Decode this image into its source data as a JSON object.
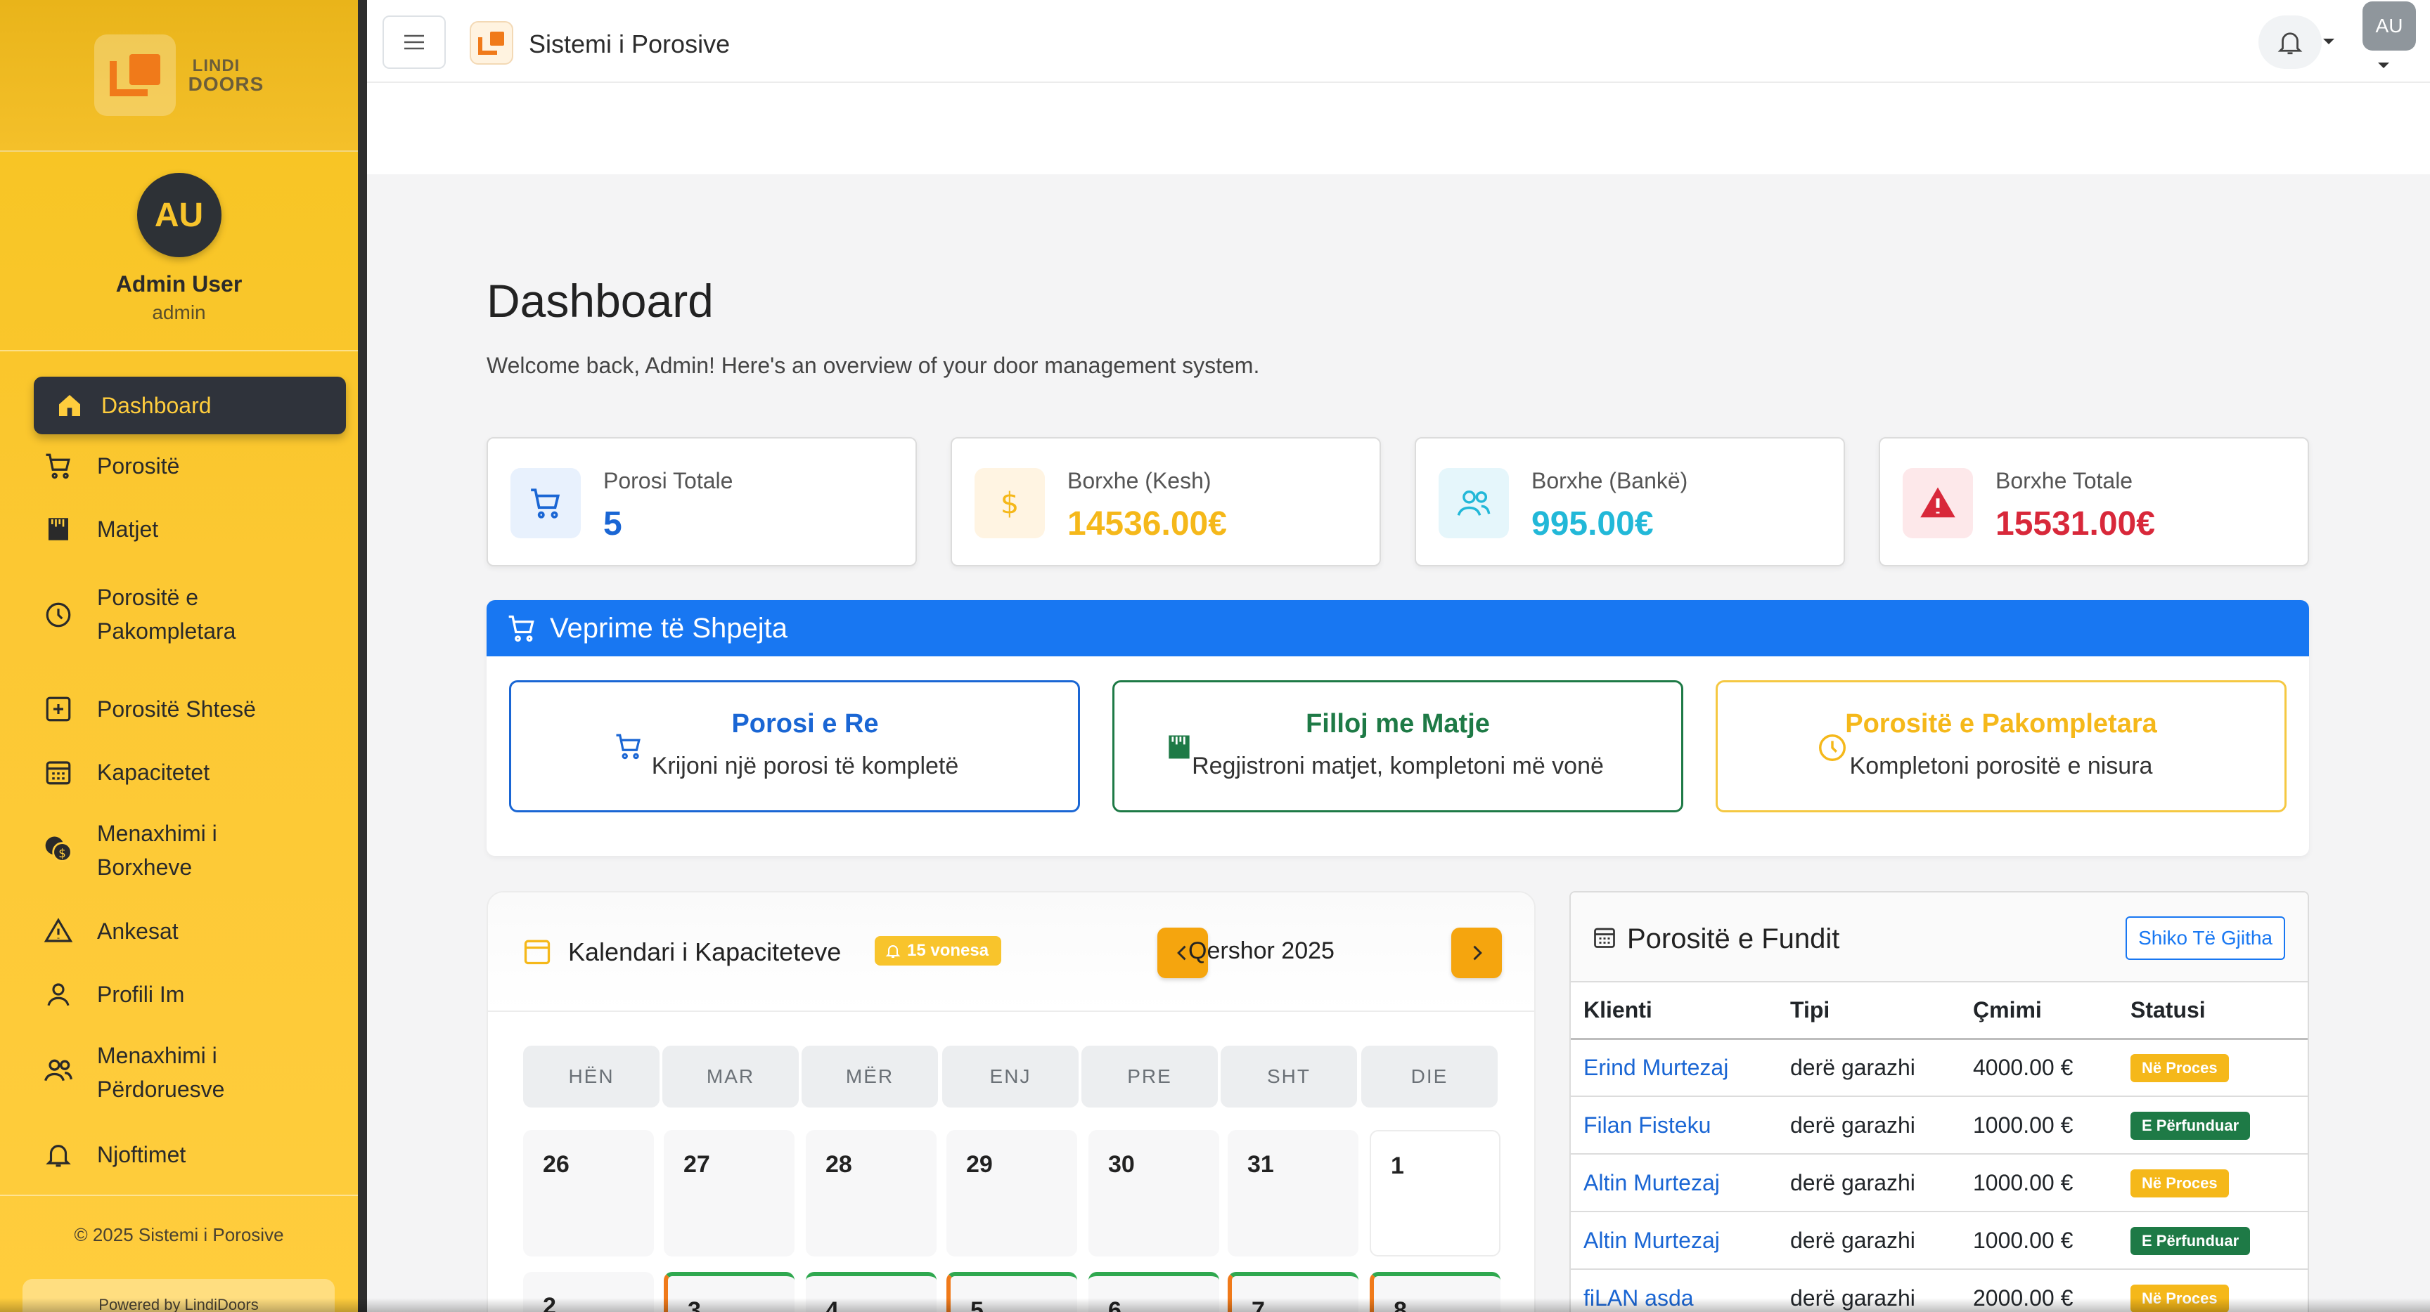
{
  "sidebar": {
    "logo_line1": "LINDI",
    "logo_line2": "DOORS",
    "avatar_initials": "AU",
    "user_name": "Admin User",
    "user_role": "admin",
    "items": [
      {
        "label": "Dashboard",
        "icon": "home-icon"
      },
      {
        "label": "Porositë",
        "icon": "cart-icon"
      },
      {
        "label": "Matjet",
        "icon": "ruler-icon"
      },
      {
        "label": "Porositë e Pakompletara",
        "icon": "clock-icon"
      },
      {
        "label": "Porositë Shtesë",
        "icon": "plus-square-icon"
      },
      {
        "label": "Kapacitetet",
        "icon": "calendar-grid-icon"
      },
      {
        "label": "Menaxhimi i Borxheve",
        "icon": "coins-icon"
      },
      {
        "label": "Ankesat",
        "icon": "warning-icon"
      },
      {
        "label": "Profili Im",
        "icon": "user-icon"
      },
      {
        "label": "Menaxhimi i Përdoruesve",
        "icon": "users-icon"
      },
      {
        "label": "Njoftimet",
        "icon": "bell-icon"
      }
    ],
    "footer": "© 2025 Sistemi i Porosive",
    "powered": "Powered by LindiDoors"
  },
  "topbar": {
    "title": "Sistemi i Porosive",
    "avatar": "AU"
  },
  "page": {
    "title": "Dashboard",
    "subtitle": "Welcome back, Admin! Here's an overview of your door management system."
  },
  "stats": [
    {
      "label": "Porosi Totale",
      "value": "5",
      "color": "#1a66d4",
      "bg": "#e8f1fd",
      "icon": "cart-icon"
    },
    {
      "label": "Borxhe (Kesh)",
      "value": "14536.00€",
      "color": "#f5b81a",
      "bg": "#fff4e2",
      "icon": "dollar-icon"
    },
    {
      "label": "Borxhe (Bankë)",
      "value": "995.00€",
      "color": "#22b8d8",
      "bg": "#e5f6fb",
      "icon": "users-icon"
    },
    {
      "label": "Borxhe Totale",
      "value": "15531.00€",
      "color": "#d8283a",
      "bg": "#fde8ea",
      "icon": "warning-icon"
    }
  ],
  "quick_actions": {
    "title": "Veprime të Shpejta",
    "cards": [
      {
        "title": "Porosi e Re",
        "subtitle": "Krijoni një porosi të kompletë",
        "color": "#1a66d4"
      },
      {
        "title": "Filloj me Matje",
        "subtitle": "Regjistroni matjet, kompletoni më vonë",
        "color": "#1e7a46"
      },
      {
        "title": "Porositë e Pakompletara",
        "subtitle": "Kompletoni porositë e nisura",
        "color": "#f5b81a"
      }
    ]
  },
  "calendar": {
    "title": "Kalendari i Kapaciteteve",
    "badge": "15 vonesa",
    "month": "Qershor 2025",
    "weekdays": [
      "HËN",
      "MAR",
      "MËR",
      "ENJ",
      "PRE",
      "SHT",
      "DIE"
    ],
    "week1": [
      "26",
      "27",
      "28",
      "29",
      "30",
      "31",
      "1"
    ],
    "week2": [
      "2",
      "3",
      "4",
      "5",
      "6",
      "7",
      "8"
    ]
  },
  "recent_orders": {
    "title": "Porositë e Fundit",
    "view_all": "Shiko Të Gjitha",
    "columns": [
      "Klienti",
      "Tipi",
      "Çmimi",
      "Statusi"
    ],
    "rows": [
      {
        "client": "Erind Murtezaj",
        "type": "derë garazhi",
        "price": "4000.00 €",
        "status": "Në Proces",
        "status_color": "#f5b81a"
      },
      {
        "client": "Filan Fisteku",
        "type": "derë garazhi",
        "price": "1000.00 €",
        "status": "E Përfunduar",
        "status_color": "#1e7a46"
      },
      {
        "client": "Altin Murtezaj",
        "type": "derë garazhi",
        "price": "1000.00 €",
        "status": "Në Proces",
        "status_color": "#f5b81a"
      },
      {
        "client": "Altin Murtezaj",
        "type": "derë garazhi",
        "price": "1000.00 €",
        "status": "E Përfunduar",
        "status_color": "#1e7a46"
      },
      {
        "client": "fiLAN asda",
        "type": "derë garazhi",
        "price": "2000.00 €",
        "status": "Në Proces",
        "status_color": "#f5b81a"
      }
    ]
  }
}
